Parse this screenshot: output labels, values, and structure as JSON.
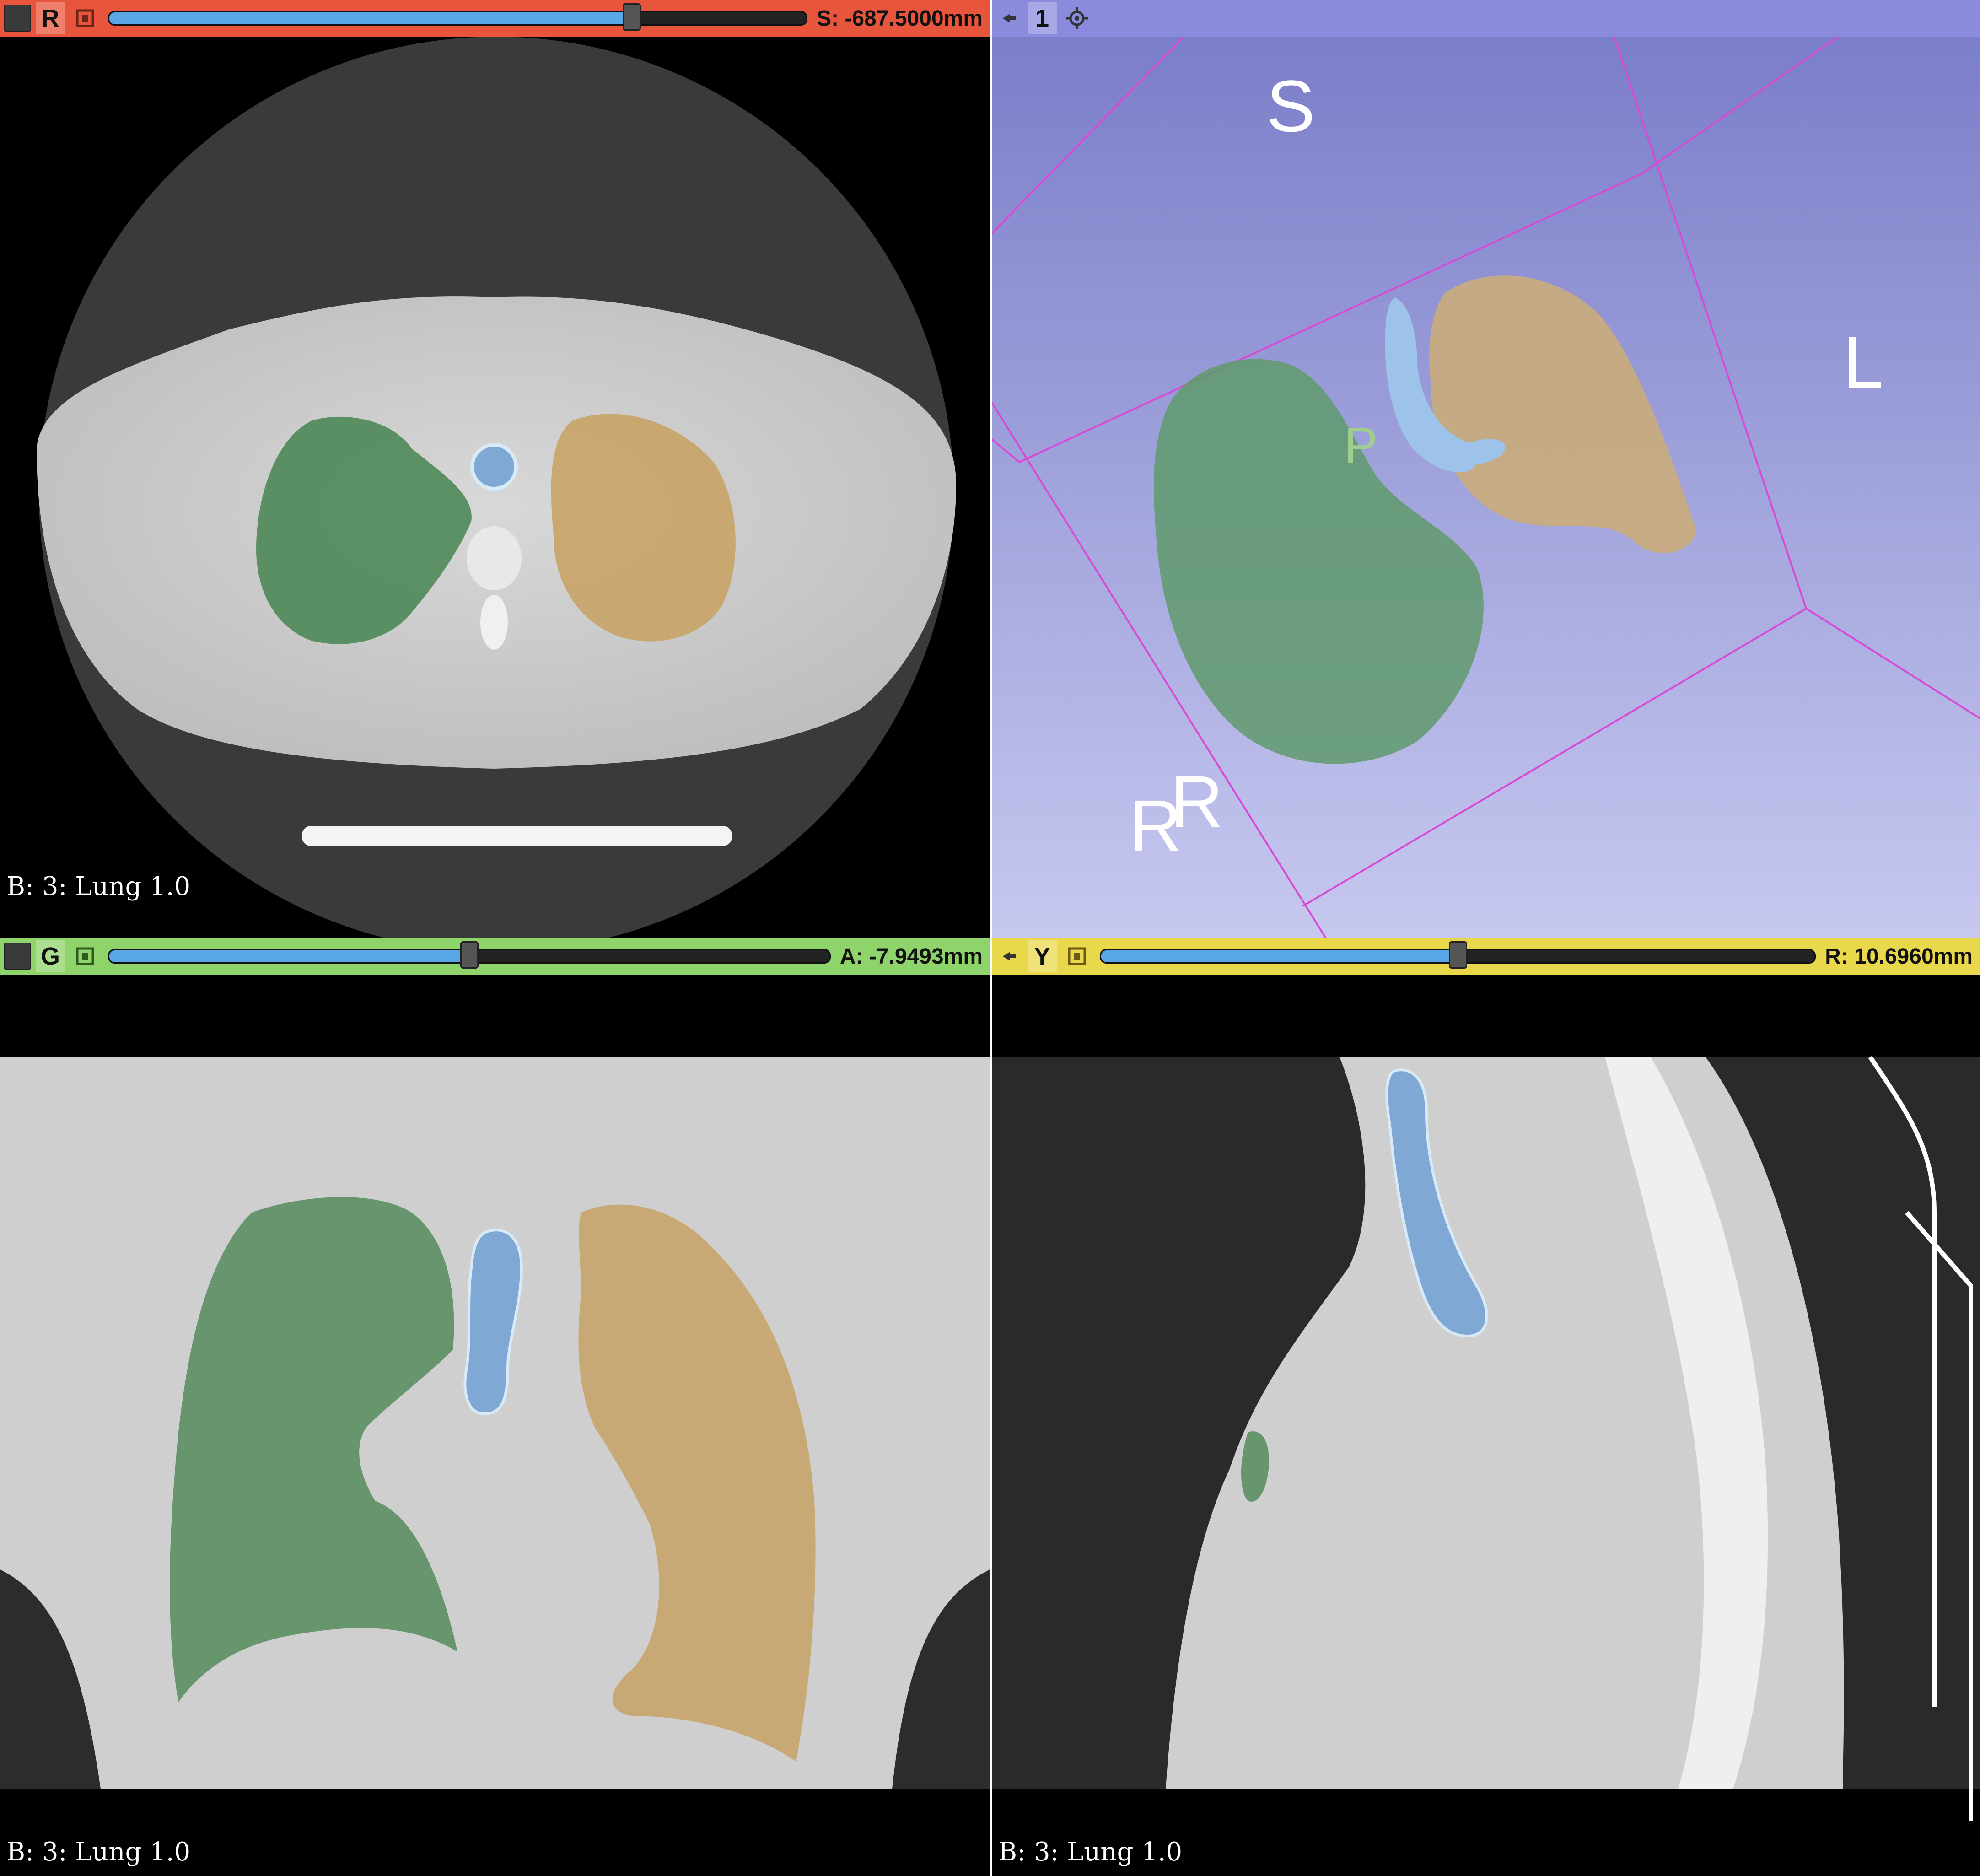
{
  "views": {
    "red": {
      "letter": "R",
      "offset": "S: -687.5000mm",
      "slider_fraction": 0.75,
      "overlay": "B: 3: Lung 1.0",
      "bar_color": "#e8553d"
    },
    "threed": {
      "letter": "1",
      "bar_color": "#8a8bdc",
      "orientation": {
        "superior": "S",
        "left": "L",
        "right": "R",
        "posterior": "P"
      }
    },
    "green": {
      "letter": "G",
      "offset": "A: -7.9493mm",
      "slider_fraction": 0.5,
      "overlay": "B: 3: Lung 1.0",
      "bar_color": "#8fd46a"
    },
    "yellow": {
      "letter": "Y",
      "offset": "R: 10.6960mm",
      "slider_fraction": 0.5,
      "overlay": "B: 3: Lung 1.0",
      "bar_color": "#ead84c"
    }
  },
  "segments": {
    "right_lung_color": "#4f8a5a",
    "left_lung_color": "#c9a469",
    "airway_color": "#7fa9d4"
  },
  "icons": {
    "pin": "pin-icon",
    "link": "link-icon",
    "arrow": "pin-arrow-icon"
  }
}
